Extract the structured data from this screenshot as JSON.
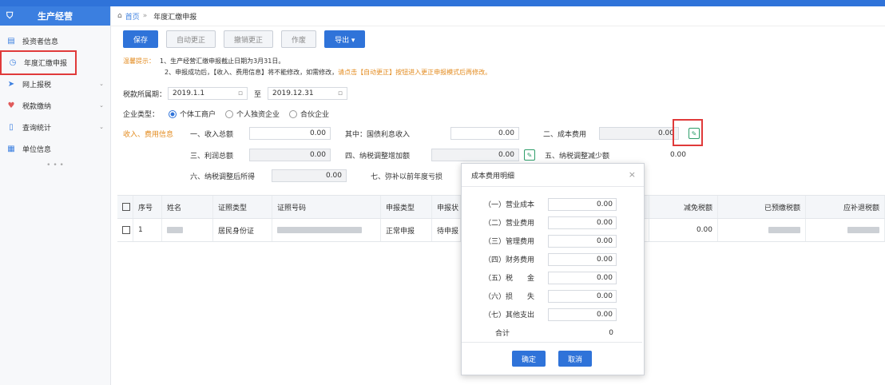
{
  "sidebar": {
    "title": "生产经营",
    "items": [
      {
        "label": "投资者信息",
        "icon": "document-icon"
      },
      {
        "label": "年度汇缴申报",
        "icon": "refresh-icon"
      },
      {
        "label": "网上报税",
        "icon": "send-icon"
      },
      {
        "label": "税款缴纳",
        "icon": "heart-icon"
      },
      {
        "label": "查询统计",
        "icon": "page-icon"
      },
      {
        "label": "单位信息",
        "icon": "grid-icon"
      }
    ],
    "dots": "• • •"
  },
  "breadcrumb": {
    "home": "首页",
    "sep": "»",
    "current": "年度汇缴申报"
  },
  "toolbar": {
    "save": "保存",
    "auto_correct": "自动更正",
    "cancel_correct": "撤销更正",
    "void": "作废",
    "export": "导出 ▾"
  },
  "tips": {
    "label": "温馨提示：",
    "line1": "1、生产经营汇缴申报截止日期为3月31日。",
    "line2_a": "2、申报成功后，【收入、费用信息】将不能修改，如需修改，",
    "line2_b": "请点击【自动更正】按钮进入更正申报模式后再修改。"
  },
  "period": {
    "label": "税款所属期：",
    "start": "2019.1.1",
    "to": "至",
    "end": "2019.12.31"
  },
  "company_type": {
    "label": "企业类型：",
    "opt1": "个体工商户",
    "opt2": "个人独资企业",
    "opt3": "合伙企业"
  },
  "income": {
    "section_label": "收入、费用信息",
    "total_income_label": "一、收入总额",
    "total_income": "0.00",
    "of_which_label": "其中：国债利息收入",
    "of_which": "0.00",
    "cost_label": "二、成本费用",
    "cost": "0.00",
    "profit_label": "三、利润总额",
    "profit": "0.00",
    "adjust_add_label": "四、纳税调整增加额",
    "adjust_add": "0.00",
    "adjust_sub_label": "五、纳税调整减少额",
    "adjust_sub": "0.00",
    "adjusted_label": "六、纳税调整后所得",
    "adjusted": "0.00",
    "loss_label": "七、弥补以前年度亏损"
  },
  "table": {
    "headers": [
      "序号",
      "姓名",
      "证照类型",
      "证照号码",
      "申报类型",
      "申报状",
      "减免税额",
      "已预缴税额",
      "应补退税额"
    ],
    "row": {
      "index": "1",
      "id_type": "居民身份证",
      "report_type": "正常申报",
      "status": "待申报",
      "reduce": "0.00"
    }
  },
  "modal": {
    "title": "成本费用明细",
    "rows": [
      {
        "label": "（一）营业成本",
        "value": "0.00"
      },
      {
        "label": "（二）营业费用",
        "value": "0.00"
      },
      {
        "label": "（三）管理费用",
        "value": "0.00"
      },
      {
        "label": "（四）财务费用",
        "value": "0.00"
      },
      {
        "label": "（五）税　　金",
        "value": "0.00"
      },
      {
        "label": "（六）损　　失",
        "value": "0.00"
      },
      {
        "label": "（七）其他支出",
        "value": "0.00"
      }
    ],
    "total_label": "合计",
    "total": "0",
    "ok": "确定",
    "cancel": "取消"
  }
}
